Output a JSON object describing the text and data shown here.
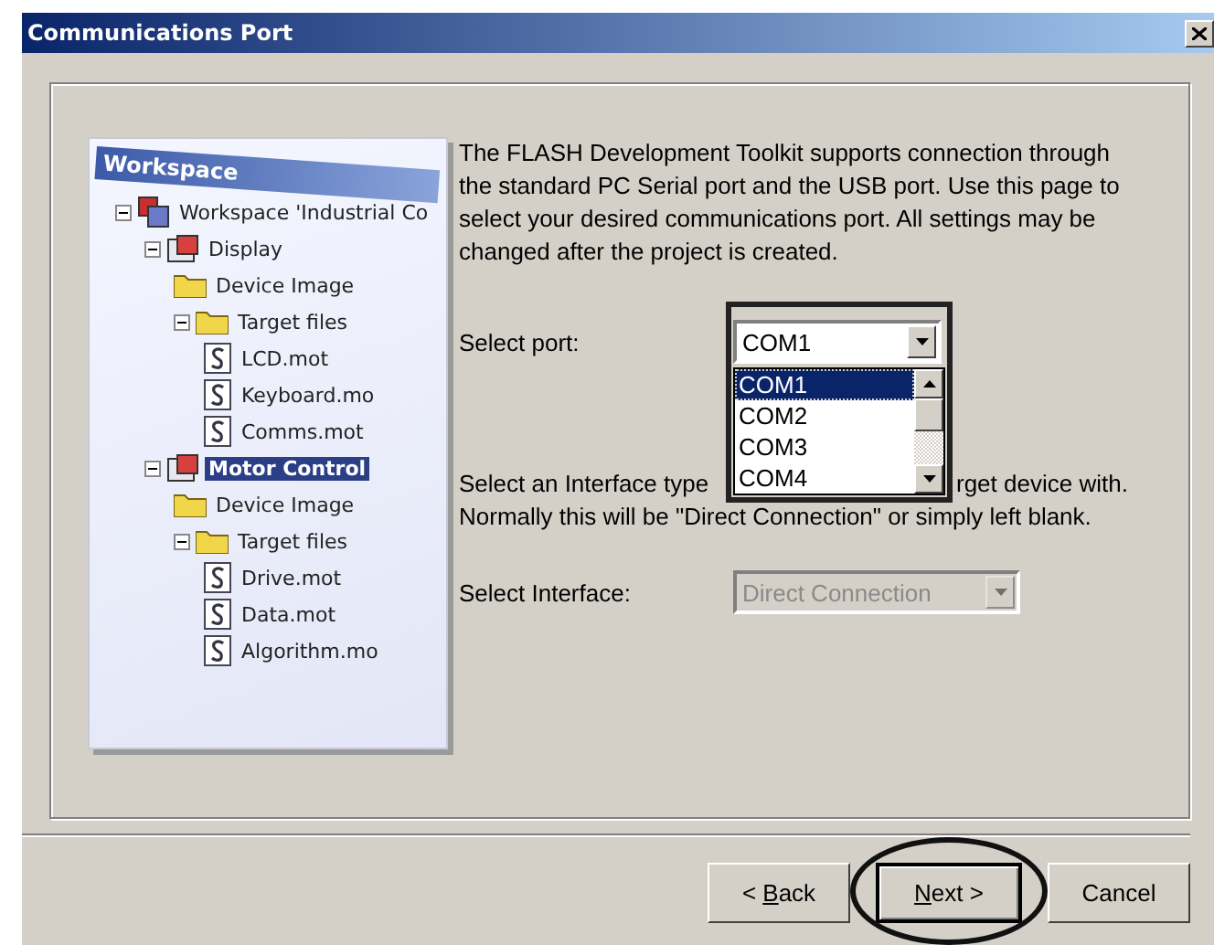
{
  "window": {
    "title": "Communications Port"
  },
  "illustration": {
    "title": "Workspace",
    "tree": [
      {
        "kind": "workspace",
        "label": "Workspace 'Industrial Co",
        "selected": false,
        "expanded": true,
        "children": [
          {
            "kind": "project",
            "label": "Display",
            "selected": false,
            "expanded": true,
            "children": [
              {
                "kind": "folder",
                "label": "Device Image",
                "selected": false
              },
              {
                "kind": "folder",
                "label": "Target files",
                "selected": false,
                "expanded": true,
                "children": [
                  {
                    "kind": "file",
                    "label": "LCD.mot",
                    "selected": false
                  },
                  {
                    "kind": "file",
                    "label": "Keyboard.mo",
                    "selected": false
                  },
                  {
                    "kind": "file",
                    "label": "Comms.mot",
                    "selected": false
                  }
                ]
              }
            ]
          },
          {
            "kind": "project",
            "label": "Motor Control",
            "selected": true,
            "expanded": true,
            "children": [
              {
                "kind": "folder",
                "label": "Device Image",
                "selected": false
              },
              {
                "kind": "folder",
                "label": "Target files",
                "selected": false,
                "expanded": true,
                "children": [
                  {
                    "kind": "file",
                    "label": "Drive.mot",
                    "selected": false
                  },
                  {
                    "kind": "file",
                    "label": "Data.mot",
                    "selected": false
                  },
                  {
                    "kind": "file",
                    "label": "Algorithm.mo",
                    "selected": false
                  }
                ]
              }
            ]
          }
        ]
      }
    ]
  },
  "description": "The FLASH Development Toolkit supports connection through the standard PC Serial port and the USB port. Use this page to select your desired communications port. All settings may be changed after the project is created.",
  "port": {
    "label": "Select port:",
    "value": "COM1",
    "open": true,
    "highlighted": true,
    "options": [
      {
        "label": "COM1",
        "selected": true
      },
      {
        "label": "COM2",
        "selected": false
      },
      {
        "label": "COM3",
        "selected": false
      },
      {
        "label": "COM4",
        "selected": false
      }
    ]
  },
  "interface_text": [
    "Select an Interface type",
    "rget device with.",
    "Normally this will be \"Direct Connection\" or simply left blank."
  ],
  "interface": {
    "label": "Select Interface:",
    "value": "Direct Connection",
    "disabled": true
  },
  "buttons": [
    {
      "before": "< ",
      "key": "B",
      "after": "ack",
      "default": false,
      "highlighted": false
    },
    {
      "key": "N",
      "after": "ext >",
      "default": true,
      "highlighted": true
    },
    {
      "after": "Cancel",
      "default": false,
      "highlighted": false
    }
  ]
}
